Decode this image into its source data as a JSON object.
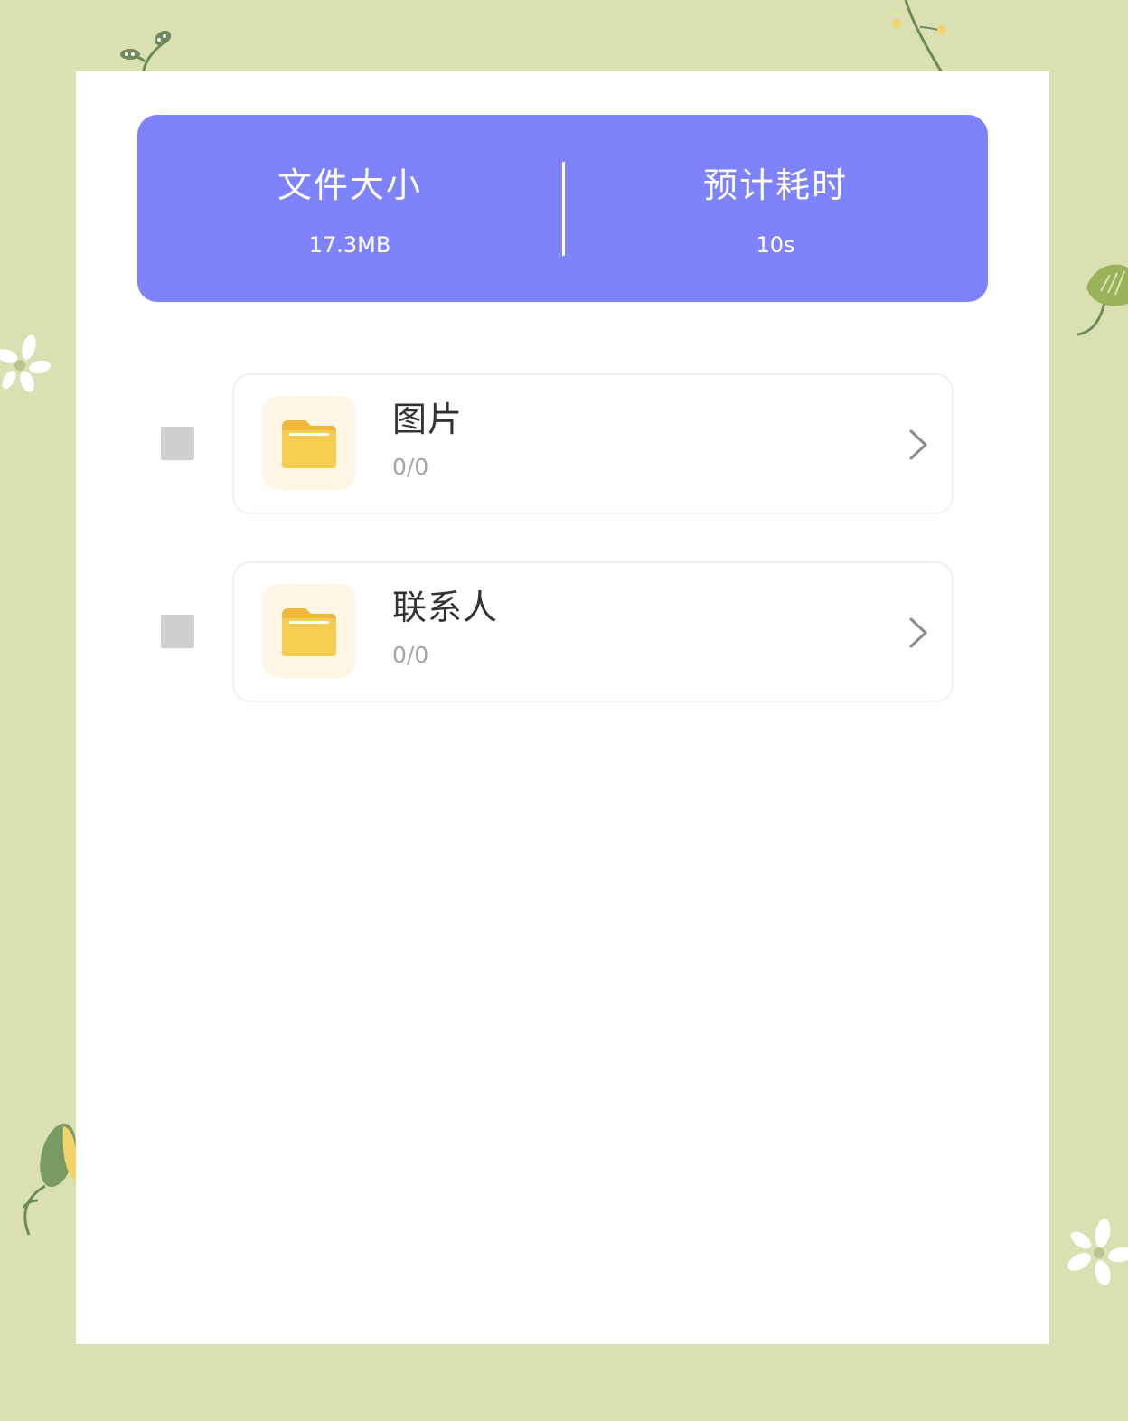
{
  "summary": {
    "file_size_label": "文件大小",
    "file_size_value": "17.3MB",
    "time_label": "预计耗时",
    "time_value": "10s"
  },
  "items": [
    {
      "title": "图片",
      "count": "0/0",
      "checked": false
    },
    {
      "title": "联系人",
      "count": "0/0",
      "checked": false
    }
  ],
  "colors": {
    "background": "#dbe0b2",
    "summary_bg": "#7f83fb",
    "folder": "#f7cd4f",
    "folder_tile": "#fdf6e6",
    "checkbox": "#cfcfcf"
  },
  "icons": [
    "folder-icon",
    "chevron-right-icon"
  ]
}
